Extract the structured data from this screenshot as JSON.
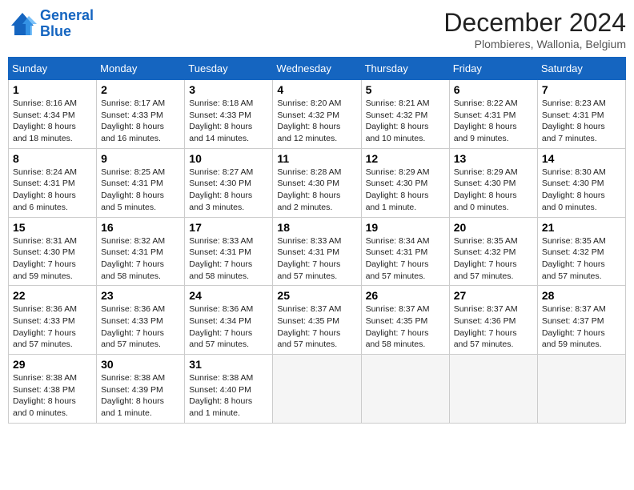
{
  "logo": {
    "line1": "General",
    "line2": "Blue"
  },
  "title": "December 2024",
  "location": "Plombieres, Wallonia, Belgium",
  "days_of_week": [
    "Sunday",
    "Monday",
    "Tuesday",
    "Wednesday",
    "Thursday",
    "Friday",
    "Saturday"
  ],
  "weeks": [
    [
      {
        "day": "1",
        "sunrise": "8:16 AM",
        "sunset": "4:34 PM",
        "daylight": "8 hours and 18 minutes."
      },
      {
        "day": "2",
        "sunrise": "8:17 AM",
        "sunset": "4:33 PM",
        "daylight": "8 hours and 16 minutes."
      },
      {
        "day": "3",
        "sunrise": "8:18 AM",
        "sunset": "4:33 PM",
        "daylight": "8 hours and 14 minutes."
      },
      {
        "day": "4",
        "sunrise": "8:20 AM",
        "sunset": "4:32 PM",
        "daylight": "8 hours and 12 minutes."
      },
      {
        "day": "5",
        "sunrise": "8:21 AM",
        "sunset": "4:32 PM",
        "daylight": "8 hours and 10 minutes."
      },
      {
        "day": "6",
        "sunrise": "8:22 AM",
        "sunset": "4:31 PM",
        "daylight": "8 hours and 9 minutes."
      },
      {
        "day": "7",
        "sunrise": "8:23 AM",
        "sunset": "4:31 PM",
        "daylight": "8 hours and 7 minutes."
      }
    ],
    [
      {
        "day": "8",
        "sunrise": "8:24 AM",
        "sunset": "4:31 PM",
        "daylight": "8 hours and 6 minutes."
      },
      {
        "day": "9",
        "sunrise": "8:25 AM",
        "sunset": "4:31 PM",
        "daylight": "8 hours and 5 minutes."
      },
      {
        "day": "10",
        "sunrise": "8:27 AM",
        "sunset": "4:30 PM",
        "daylight": "8 hours and 3 minutes."
      },
      {
        "day": "11",
        "sunrise": "8:28 AM",
        "sunset": "4:30 PM",
        "daylight": "8 hours and 2 minutes."
      },
      {
        "day": "12",
        "sunrise": "8:29 AM",
        "sunset": "4:30 PM",
        "daylight": "8 hours and 1 minute."
      },
      {
        "day": "13",
        "sunrise": "8:29 AM",
        "sunset": "4:30 PM",
        "daylight": "8 hours and 0 minutes."
      },
      {
        "day": "14",
        "sunrise": "8:30 AM",
        "sunset": "4:30 PM",
        "daylight": "8 hours and 0 minutes."
      }
    ],
    [
      {
        "day": "15",
        "sunrise": "8:31 AM",
        "sunset": "4:30 PM",
        "daylight": "7 hours and 59 minutes."
      },
      {
        "day": "16",
        "sunrise": "8:32 AM",
        "sunset": "4:31 PM",
        "daylight": "7 hours and 58 minutes."
      },
      {
        "day": "17",
        "sunrise": "8:33 AM",
        "sunset": "4:31 PM",
        "daylight": "7 hours and 58 minutes."
      },
      {
        "day": "18",
        "sunrise": "8:33 AM",
        "sunset": "4:31 PM",
        "daylight": "7 hours and 57 minutes."
      },
      {
        "day": "19",
        "sunrise": "8:34 AM",
        "sunset": "4:31 PM",
        "daylight": "7 hours and 57 minutes."
      },
      {
        "day": "20",
        "sunrise": "8:35 AM",
        "sunset": "4:32 PM",
        "daylight": "7 hours and 57 minutes."
      },
      {
        "day": "21",
        "sunrise": "8:35 AM",
        "sunset": "4:32 PM",
        "daylight": "7 hours and 57 minutes."
      }
    ],
    [
      {
        "day": "22",
        "sunrise": "8:36 AM",
        "sunset": "4:33 PM",
        "daylight": "7 hours and 57 minutes."
      },
      {
        "day": "23",
        "sunrise": "8:36 AM",
        "sunset": "4:33 PM",
        "daylight": "7 hours and 57 minutes."
      },
      {
        "day": "24",
        "sunrise": "8:36 AM",
        "sunset": "4:34 PM",
        "daylight": "7 hours and 57 minutes."
      },
      {
        "day": "25",
        "sunrise": "8:37 AM",
        "sunset": "4:35 PM",
        "daylight": "7 hours and 57 minutes."
      },
      {
        "day": "26",
        "sunrise": "8:37 AM",
        "sunset": "4:35 PM",
        "daylight": "7 hours and 58 minutes."
      },
      {
        "day": "27",
        "sunrise": "8:37 AM",
        "sunset": "4:36 PM",
        "daylight": "7 hours and 57 minutes."
      },
      {
        "day": "28",
        "sunrise": "8:37 AM",
        "sunset": "4:37 PM",
        "daylight": "7 hours and 59 minutes."
      }
    ],
    [
      {
        "day": "29",
        "sunrise": "8:38 AM",
        "sunset": "4:38 PM",
        "daylight": "8 hours and 0 minutes."
      },
      {
        "day": "30",
        "sunrise": "8:38 AM",
        "sunset": "4:39 PM",
        "daylight": "8 hours and 1 minute."
      },
      {
        "day": "31",
        "sunrise": "8:38 AM",
        "sunset": "4:40 PM",
        "daylight": "8 hours and 1 minute."
      },
      null,
      null,
      null,
      null
    ]
  ]
}
